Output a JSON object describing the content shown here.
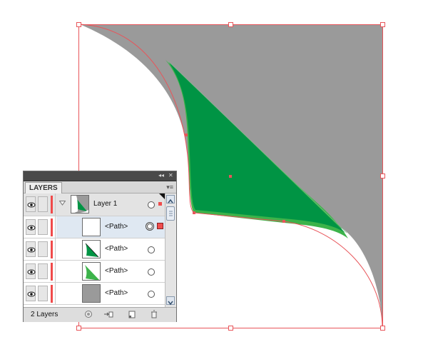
{
  "canvas": {
    "colors": {
      "artwork_gray": "#9a9a9a",
      "artwork_green": "#009444",
      "highlight_green": "#3cb34a",
      "selection": "#e8555a"
    }
  },
  "layers_panel": {
    "title_buttons": {
      "collapse": "◂◂",
      "close": "✕"
    },
    "tab_label": "LAYERS",
    "menu_icon": "▾≡",
    "layer": {
      "name": "Layer 1",
      "expanded": true,
      "visible": true,
      "selected": true
    },
    "paths": [
      {
        "name": "<Path>",
        "thumb": "white",
        "visible": true,
        "selected": true
      },
      {
        "name": "<Path>",
        "thumb": "green-triangle-dark",
        "visible": true,
        "selected": false
      },
      {
        "name": "<Path>",
        "thumb": "green-triangle-light",
        "visible": true,
        "selected": false
      },
      {
        "name": "<Path>",
        "thumb": "gray-square",
        "visible": true,
        "selected": false
      }
    ],
    "layer_color": "#f04a4a",
    "status": {
      "count_label": "2 Layers"
    },
    "bottom_icons": [
      "make-clipping-mask-icon",
      "create-sublayer-icon",
      "create-new-layer-icon",
      "delete-icon"
    ]
  }
}
